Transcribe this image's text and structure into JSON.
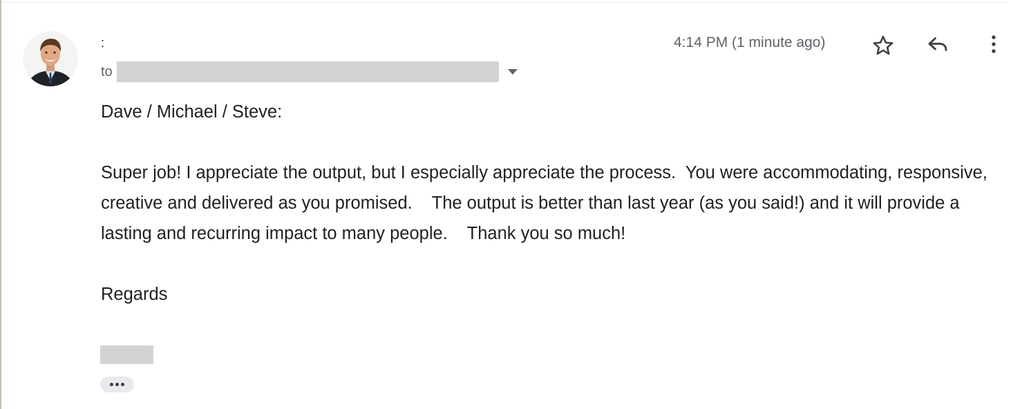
{
  "message": {
    "sender_name": ":",
    "to_label": "to",
    "timestamp": "4:14 PM (1 minute ago)",
    "greeting": "Dave / Michael / Steve:",
    "paragraph": "Super job! I appreciate the output, but I especially appreciate the process.  You were accommodating, responsive, creative and delivered as you promised.    The output is better than last year (as you said!) and it will provide a lasting and recurring impact to many people.    Thank you so much!",
    "closing": "Regards"
  },
  "icons": {
    "star": "star-icon",
    "reply": "reply-icon",
    "more": "more-vert-icon",
    "details": "caret-down-icon",
    "trimmed": "ellipsis-icon"
  },
  "colors": {
    "text": "#202124",
    "secondary_text": "#5f6368",
    "redaction": "#d3d3d3",
    "chip": "#e8eaed"
  }
}
